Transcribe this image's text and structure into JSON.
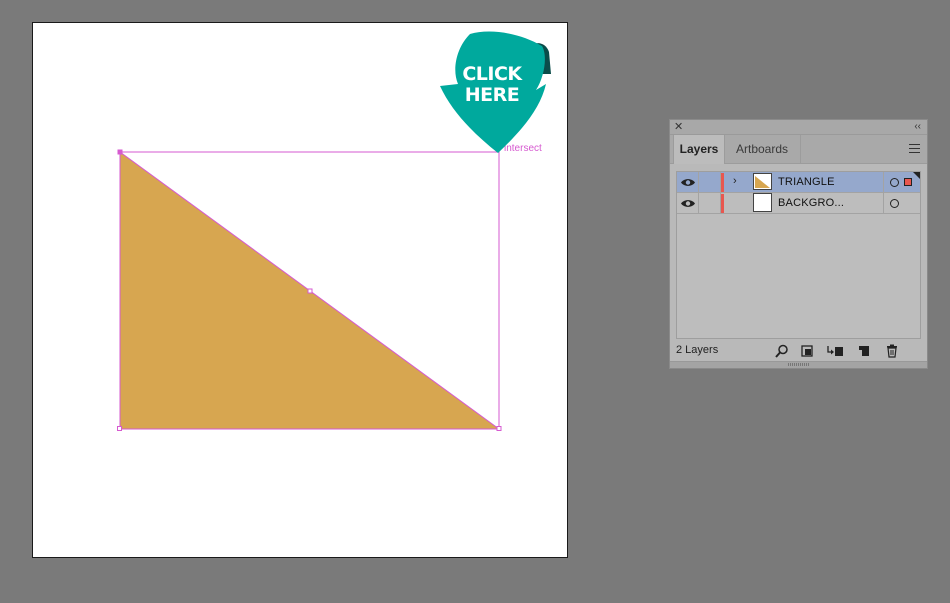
{
  "canvas": {
    "smart_guide_label": "intersect",
    "triangle_fill": "#d7a650",
    "selection_color": "#d65ad0"
  },
  "callout": {
    "line1": "CLICK",
    "line2": "HERE",
    "color": "#00a99d",
    "fold_color": "#0b4d4a"
  },
  "layers_panel": {
    "close_icon": "close-icon",
    "collapse_icon": "double-chevron-left-icon",
    "tabs": [
      {
        "label": "Layers",
        "active": true
      },
      {
        "label": "Artboards",
        "active": false
      }
    ],
    "menu_icon": "panel-menu-icon",
    "layers": [
      {
        "name": "TRIANGLE",
        "selected": true,
        "expanded": false,
        "color": "#e8574f"
      },
      {
        "name": "BACKGRO...",
        "selected": false,
        "expanded": false,
        "color": "#e8574f"
      }
    ],
    "footer": {
      "count_label": "2 Layers",
      "icons": [
        "locate-object-icon",
        "make-clipping-mask-icon",
        "create-sublayer-icon",
        "create-new-layer-icon",
        "trash-icon"
      ]
    }
  }
}
